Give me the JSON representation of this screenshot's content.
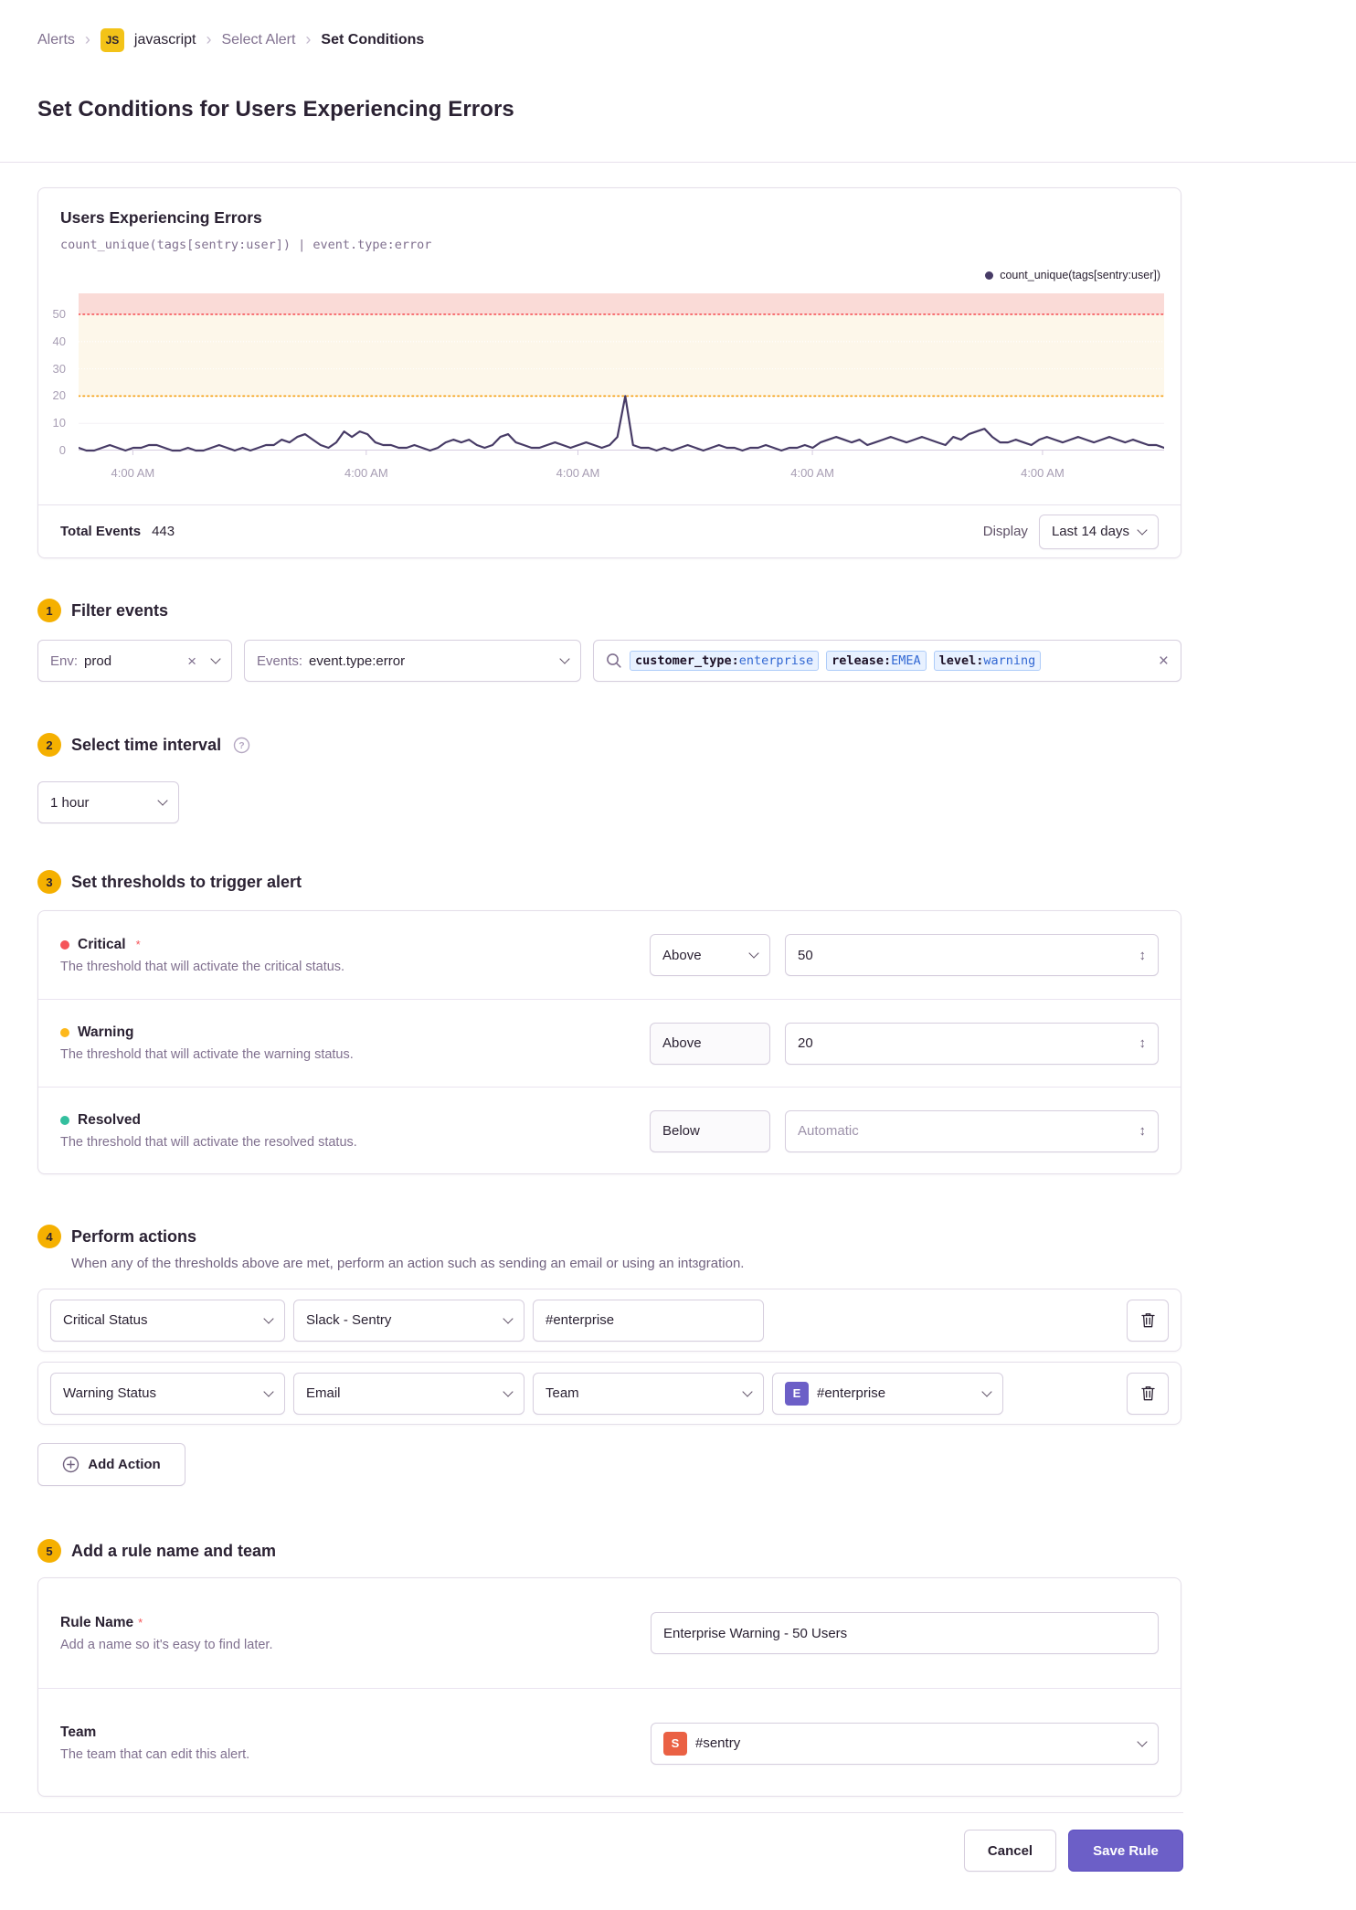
{
  "colors": {
    "accent": "#6C5FC7",
    "section_badge": "#F5B000",
    "js_badge": "#F3C318",
    "critical": "#F55459",
    "warning": "#FDB81B",
    "resolved": "#33BF9E"
  },
  "ui": {
    "required_mark": "*"
  },
  "breadcrumb": {
    "alerts": "Alerts",
    "project_badge": "JS",
    "project": "javascript",
    "select_alert": "Select Alert",
    "current": "Set Conditions"
  },
  "page_title": "Set Conditions for Users Experiencing Errors",
  "chart": {
    "title": "Users Experiencing Errors",
    "query": "count_unique(tags[sentry:user]) | event.type:error",
    "legend": "count_unique(tags[sentry:user])",
    "total_events_label": "Total Events",
    "total_events_value": "443",
    "display_label": "Display",
    "display_value": "Last 14 days"
  },
  "chart_data": {
    "type": "line",
    "title": "Users Experiencing Errors",
    "series": [
      {
        "name": "count_unique(tags[sentry:user])",
        "values": [
          1,
          0,
          0,
          1,
          2,
          1,
          0,
          1,
          1,
          2,
          2,
          1,
          0,
          0,
          1,
          0,
          0,
          1,
          2,
          1,
          0,
          1,
          0,
          1,
          2,
          2,
          4,
          3,
          5,
          6,
          4,
          2,
          1,
          3,
          7,
          5,
          7,
          6,
          3,
          2,
          2,
          1,
          1,
          2,
          1,
          0,
          1,
          3,
          4,
          3,
          4,
          2,
          1,
          2,
          5,
          6,
          3,
          2,
          1,
          1,
          2,
          3,
          2,
          1,
          2,
          3,
          2,
          1,
          2,
          5,
          20,
          2,
          1,
          1,
          0,
          1,
          0,
          1,
          2,
          1,
          0,
          1,
          2,
          1,
          1,
          0,
          1,
          1,
          2,
          1,
          0,
          1,
          1,
          2,
          1,
          3,
          4,
          5,
          4,
          3,
          4,
          2,
          3,
          4,
          5,
          4,
          3,
          4,
          5,
          4,
          3,
          2,
          5,
          4,
          6,
          7,
          8,
          5,
          3,
          3,
          4,
          3,
          2,
          4,
          5,
          4,
          3,
          4,
          5,
          4,
          3,
          4,
          5,
          4,
          3,
          4,
          3,
          2,
          2,
          1
        ]
      }
    ],
    "x_tick_labels": [
      "4:00 AM",
      "4:00 AM",
      "4:00 AM",
      "4:00 AM",
      "4:00 AM"
    ],
    "x_tick_positions": [
      0.05,
      0.265,
      0.46,
      0.676,
      0.888
    ],
    "y_ticks": [
      0,
      10,
      20,
      30,
      40,
      50
    ],
    "ylim": [
      0,
      57.7
    ],
    "grid": "horizontal",
    "legend_position": "top-right",
    "thresholds": {
      "critical": 50,
      "warning": 20
    },
    "colors": {
      "line": "#473B66",
      "critical_zone": "#FADBD7",
      "warning_zone": "#FDF7EA",
      "critical_line": "#F55459",
      "warning_line": "#F5A31A"
    }
  },
  "filter": {
    "number": "1",
    "title": "Filter events",
    "env_label": "Env:",
    "env_value": "prod",
    "events_label": "Events:",
    "events_value": "event.type:error",
    "search_tokens": [
      {
        "key": "customer_type:",
        "value": "enterprise"
      },
      {
        "key": "release:",
        "value": "EMEA"
      },
      {
        "key": "level:",
        "value": "warning"
      }
    ]
  },
  "interval": {
    "number": "2",
    "title": "Select time interval",
    "value": "1 hour"
  },
  "thresholds": {
    "number": "3",
    "title": "Set thresholds to trigger alert",
    "rows": [
      {
        "name": "Critical",
        "required": true,
        "dot_color": "#F55459",
        "description": "The threshold that will activate the critical status.",
        "condition": "Above",
        "value": "50",
        "placeholder": ""
      },
      {
        "name": "Warning",
        "required": false,
        "dot_color": "#FDB81B",
        "description": "The threshold that will activate the warning status.",
        "condition": "Above",
        "value": "20",
        "placeholder": ""
      },
      {
        "name": "Resolved",
        "required": false,
        "dot_color": "#33BF9E",
        "description": "The threshold that will activate the resolved status.",
        "condition": "Below",
        "value": "",
        "placeholder": "Automatic"
      }
    ]
  },
  "actions": {
    "number": "4",
    "title": "Perform actions",
    "subtitle": "When any of the thresholds above are met, perform an action such as sending an email or using an intɜgration.",
    "add_label": "Add Action",
    "rows": [
      {
        "controls": [
          {
            "type": "select",
            "value": "Critical Status"
          },
          {
            "type": "select",
            "value": "Slack - Sentry"
          },
          {
            "type": "input",
            "value": "#enterprise"
          }
        ]
      },
      {
        "controls": [
          {
            "type": "select",
            "value": "Warning Status"
          },
          {
            "type": "select",
            "value": "Email"
          },
          {
            "type": "select",
            "value": "Team"
          },
          {
            "type": "select",
            "value": "#enterprise",
            "badge": "E",
            "badge_color": "#6C5FC7"
          }
        ]
      }
    ]
  },
  "rule": {
    "number": "5",
    "title": "Add a rule name and team",
    "rows": [
      {
        "name": "Rule Name",
        "required": true,
        "description": "Add a name so it's easy to find later.",
        "value": "Enterprise Warning - 50 Users"
      },
      {
        "name": "Team",
        "required": false,
        "description": "The team that can edit this alert.",
        "value": "#sentry",
        "badge": "S",
        "badge_color": "#EA6144"
      }
    ]
  },
  "footer": {
    "cancel": "Cancel",
    "save": "Save Rule"
  }
}
